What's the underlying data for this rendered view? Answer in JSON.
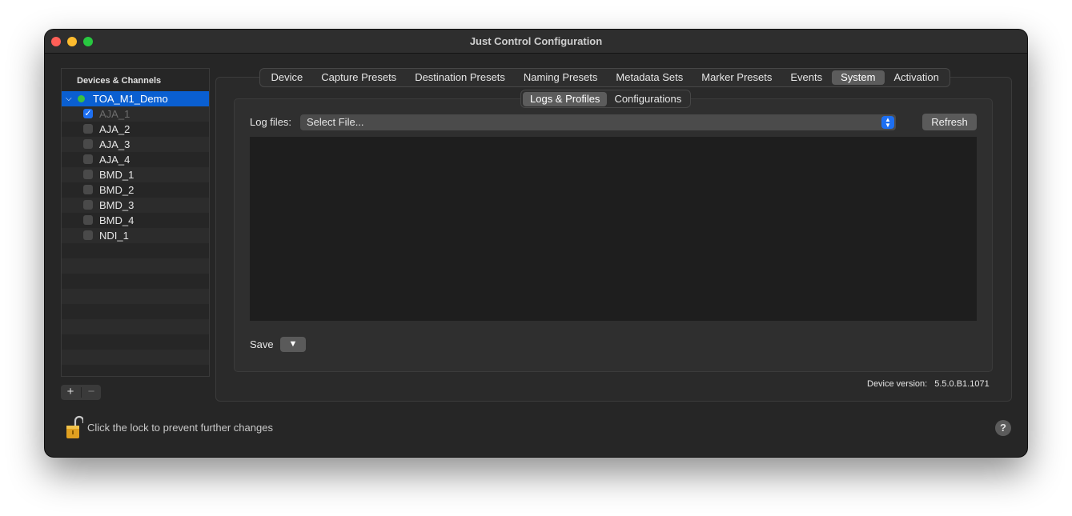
{
  "window": {
    "title": "Just Control Configuration"
  },
  "sidebar": {
    "header": "Devices & Channels",
    "device": {
      "name": "TOA_M1_Demo",
      "status_color": "#3ac140",
      "expanded": true
    },
    "channels": [
      {
        "label": "AJA_1",
        "checked": true,
        "dimmed": true
      },
      {
        "label": "AJA_2",
        "checked": false
      },
      {
        "label": "AJA_3",
        "checked": false
      },
      {
        "label": "AJA_4",
        "checked": false
      },
      {
        "label": "BMD_1",
        "checked": false
      },
      {
        "label": "BMD_2",
        "checked": false
      },
      {
        "label": "BMD_3",
        "checked": false
      },
      {
        "label": "BMD_4",
        "checked": false
      },
      {
        "label": "NDI_1",
        "checked": false
      }
    ],
    "add_label": "+",
    "remove_label": "−"
  },
  "tabs": [
    "Device",
    "Capture Presets",
    "Destination Presets",
    "Naming Presets",
    "Metadata Sets",
    "Marker Presets",
    "Events",
    "System",
    "Activation"
  ],
  "active_tab": "System",
  "subtabs": [
    "Logs & Profiles",
    "Configurations"
  ],
  "active_subtab": "Logs & Profiles",
  "logs": {
    "label": "Log files:",
    "select_value": "Select File...",
    "refresh_label": "Refresh",
    "save_label": "Save",
    "save_menu_glyph": "▼"
  },
  "device_version": {
    "label": "Device version:",
    "value": "5.5.0.B1.1071"
  },
  "footer": {
    "lock_text": "Click the lock to prevent further changes",
    "help_label": "?"
  },
  "colors": {
    "accent": "#1d6ff2",
    "selection": "#0a5fd1"
  }
}
